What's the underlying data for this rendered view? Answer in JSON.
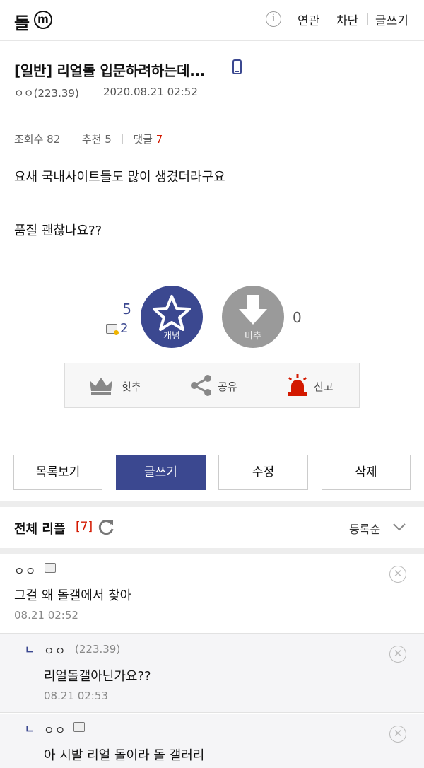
{
  "topbar": {
    "gallery_name": "돌",
    "badge": "ⓜ",
    "info_icon": "i",
    "links": [
      "연관",
      "차단",
      "글쓰기"
    ]
  },
  "post": {
    "title": "[일반] 리얼돌 입문하려하는데...",
    "writer": "ㅇㅇ(223.39)",
    "date": "2020.08.21 02:52",
    "views_label": "조회수 82",
    "recommend_label": "추천 5",
    "reply_label": "댓글",
    "reply_count": "7",
    "body": [
      "요새 국내사이트들도 많이 생겼더라구요",
      "품질 괜찮나요??"
    ]
  },
  "vote": {
    "up_count": "5",
    "fixed_count": "2",
    "up_label": "개념",
    "down_label": "비추",
    "down_count": "0"
  },
  "actions": {
    "hit": "힛추",
    "share": "공유",
    "report": "신고"
  },
  "buttons": {
    "list": "목록보기",
    "write": "글쓰기",
    "edit": "수정",
    "delete": "삭제"
  },
  "replies": {
    "title": "전체 리플",
    "count": "[7]",
    "sort": "등록순",
    "items": [
      {
        "nick": "ㅇㅇ",
        "ip": "",
        "text": "그걸 왜 돌갤에서 찾아",
        "date": "08.21 02:52"
      },
      {
        "nick": "ㅇㅇ",
        "ip": "(223.39)",
        "text": "리얼돌갤아닌가요??",
        "date": "08.21 02:53"
      },
      {
        "nick": "ㅇㅇ",
        "ip": "",
        "text": "아 시발 리얼 돌이라 돌 갤러리",
        "date": ""
      }
    ],
    "reply_mark": "ㄴ",
    "delete_glyph": "✕"
  },
  "colors": {
    "accent": "#3b4890",
    "red": "#d31900",
    "gray": "#9a9a9a"
  }
}
